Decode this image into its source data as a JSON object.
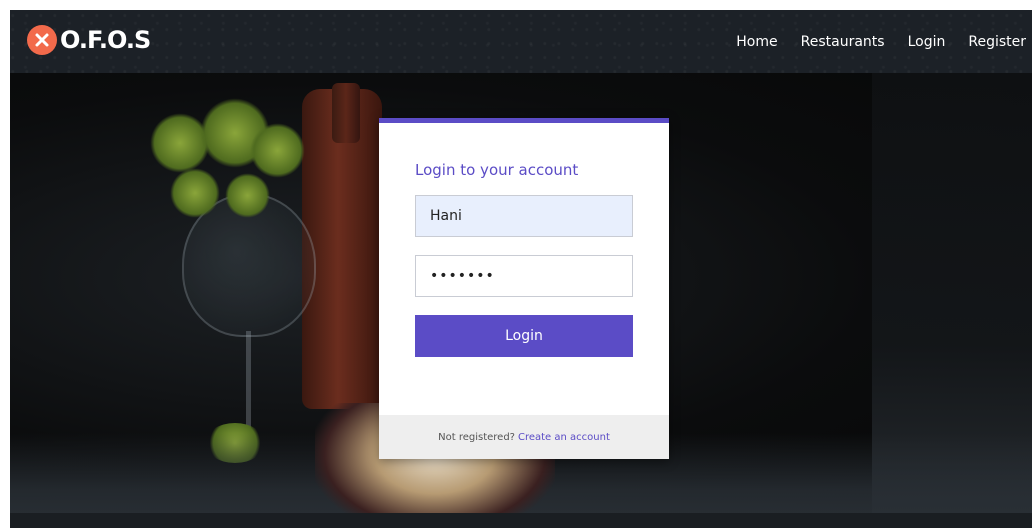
{
  "brand": {
    "name": "O.F.O.S",
    "accent": "#f26a4b",
    "icon": "utensils-icon"
  },
  "nav": {
    "items": [
      {
        "label": "Home"
      },
      {
        "label": "Restaurants"
      },
      {
        "label": "Login"
      },
      {
        "label": "Register"
      }
    ]
  },
  "login": {
    "title": "Login to your account",
    "username_value": "Hani",
    "password_value": "1234567",
    "button_label": "Login",
    "footer_text": "Not registered?",
    "footer_link": "Create an account",
    "accent": "#5b4cc6"
  }
}
